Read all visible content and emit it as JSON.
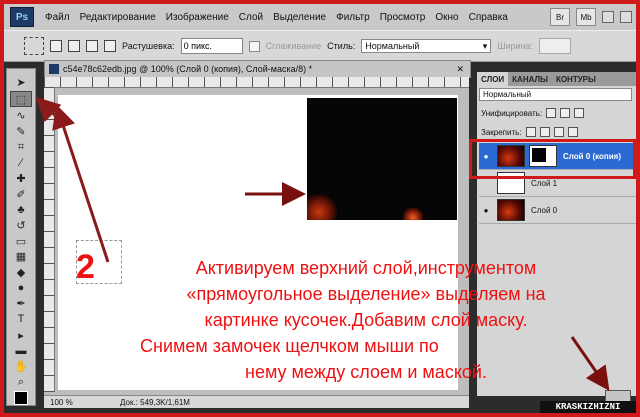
{
  "menubar": {
    "logo": "Ps",
    "items": [
      "Файл",
      "Редактирование",
      "Изображение",
      "Слой",
      "Выделение",
      "Фильтр",
      "Просмотр",
      "Окно",
      "Справка"
    ],
    "right_buttons": [
      "Br",
      "Mb"
    ]
  },
  "options": {
    "feather_label": "Растушевка:",
    "feather_value": "0 пикс.",
    "antialias_label": "Сглаживание",
    "style_label": "Стиль:",
    "style_value": "Нормальный",
    "width_label": "Ширина:"
  },
  "document": {
    "tab_title": "c54e78c62edb.jpg @ 100% (Слой 0 (копия), Слой-маска/8) *",
    "status_zoom": "100 %",
    "status_doc": "Док.: 549,3K/1,61M"
  },
  "layers_panel": {
    "tabs": [
      "СЛОИ",
      "КАНАЛЫ",
      "КОНТУРЫ"
    ],
    "blend_mode": "Нормальный",
    "unify_label": "Унифицировать:",
    "lock_label": "Закрепить:",
    "layers": [
      {
        "name": "Слой 0 (копия)",
        "selected": true
      },
      {
        "name": "Слой 1",
        "selected": false
      },
      {
        "name": "Слой 0",
        "selected": false
      }
    ]
  },
  "annotation": {
    "step": "2",
    "lines": [
      "Активируем верхний слой,инструментом",
      "«прямоугольное выделение» выделяем на",
      "картинке кусочек.Добавим слой маску.",
      "Снимем замочек щелчком мыши по",
      "нему между слоем и маской."
    ]
  },
  "watermark": "KRASKIZHIZNI",
  "colors": {
    "annotation_red": "#ee1111",
    "selection_blue": "#2b6ad3"
  }
}
